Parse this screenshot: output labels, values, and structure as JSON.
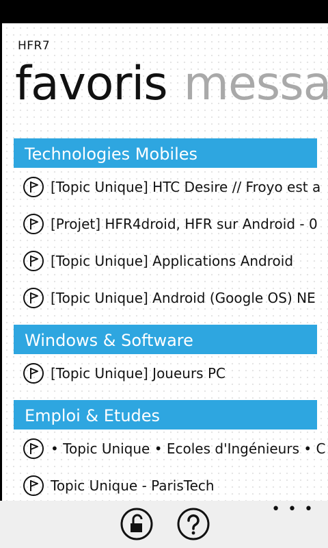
{
  "app": {
    "title": "HFR7"
  },
  "pivot": {
    "active": "favoris",
    "next": "messag"
  },
  "groups": [
    {
      "title": "Technologies Mobiles",
      "topics": [
        "[Topic Unique] HTC Desire // Froyo est a",
        "[Projet] HFR4droid, HFR sur Android - 0",
        "[Topic Unique] Applications Android",
        "[Topic Unique] Android (Google OS) NE"
      ]
    },
    {
      "title": "Windows & Software",
      "topics": [
        "[Topic Unique] Joueurs PC"
      ]
    },
    {
      "title": "Emploi & Etudes",
      "topics": [
        "• Topic Unique • Ecoles d'Ingénieurs • C",
        "Topic Unique - ParisTech"
      ]
    }
  ],
  "app_bar": {
    "buttons": [
      {
        "icon": "unlock-icon"
      },
      {
        "icon": "help-icon"
      }
    ],
    "more": "• • •"
  },
  "colors": {
    "accent": "#2ea6e0",
    "app_bar_bg": "#efefef"
  }
}
